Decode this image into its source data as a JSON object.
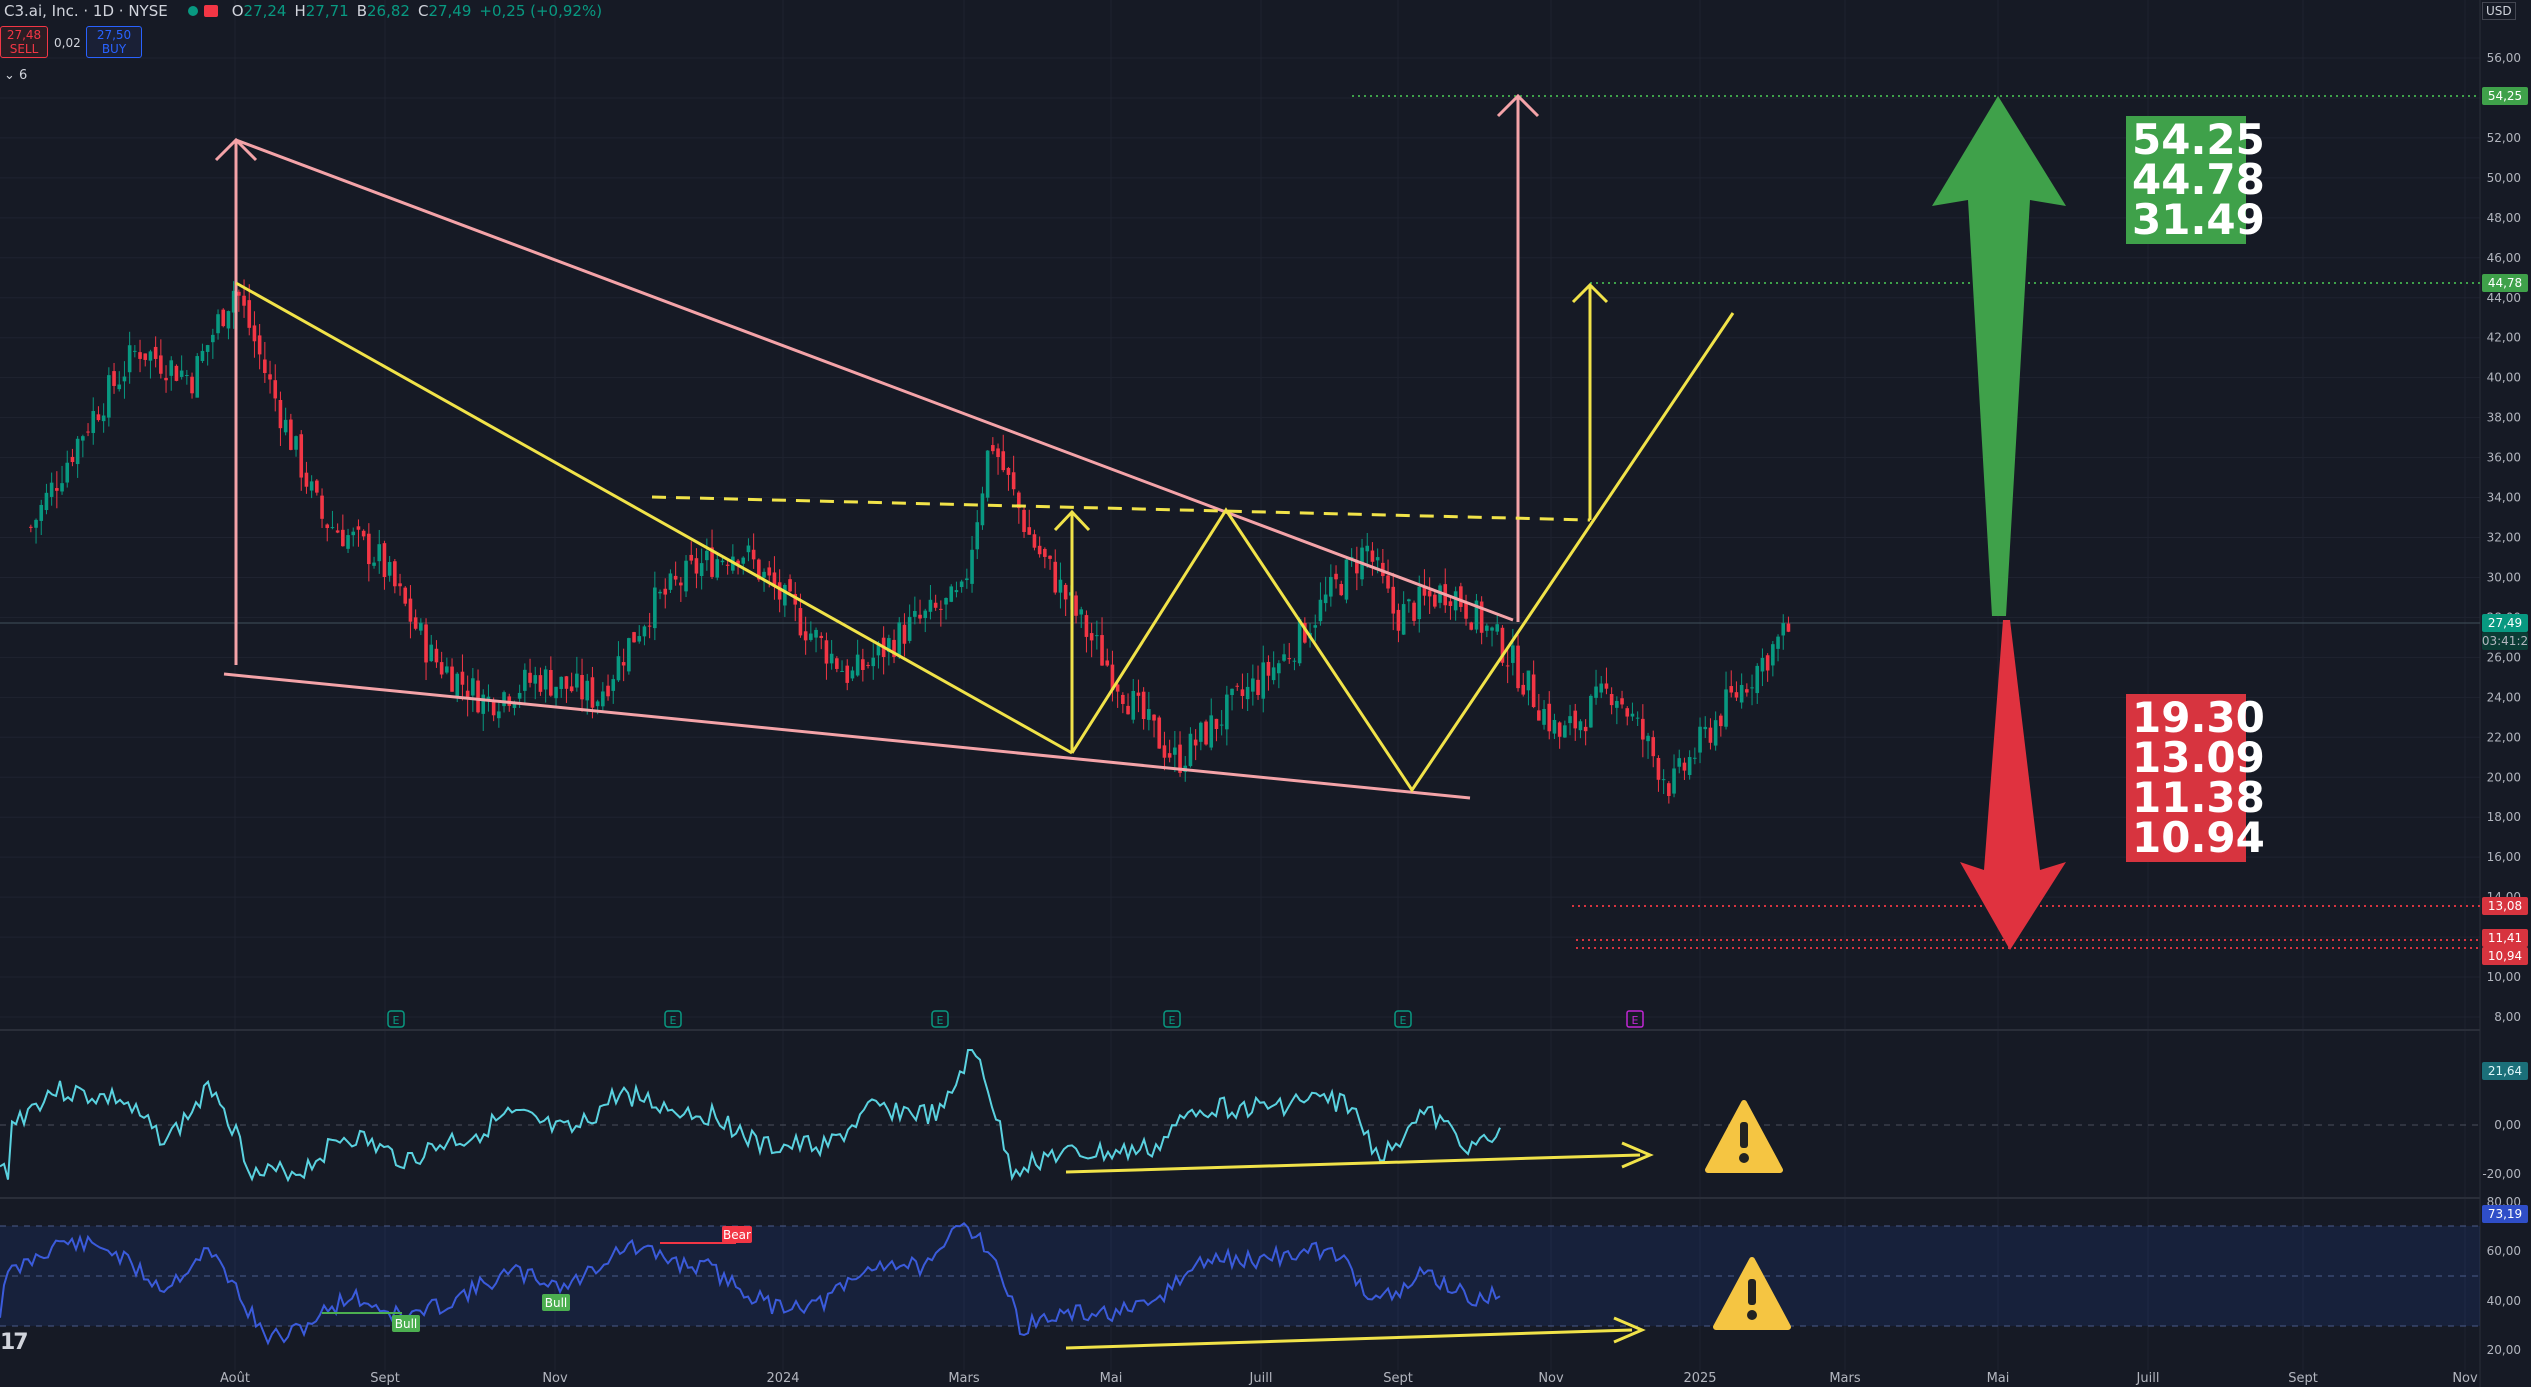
{
  "header": {
    "symbol": "C3.ai, Inc. · 1D · NYSE",
    "open_label": "O",
    "open": "27,24",
    "high_label": "H",
    "high": "27,71",
    "low_label": "B",
    "low": "26,82",
    "close_label": "C",
    "close": "27,49",
    "change": "+0,25 (+0,92%)"
  },
  "trade": {
    "sell_price": "27,48",
    "sell_label": "SELL",
    "spread": "0,02",
    "buy_price": "27,50",
    "buy_label": "BUY",
    "indicators_collapsed": "⌄ 6"
  },
  "currency": "USD",
  "targets": {
    "upside": [
      "54.25",
      "44.78",
      "31.49"
    ],
    "downside": [
      "19.30",
      "13.09",
      "11.38",
      "10.94"
    ]
  },
  "price_tags": {
    "t1": "54,25",
    "t2": "44,78",
    "current": "27,49",
    "countdown": "03:41:2",
    "s1": "13,08",
    "s2": "11,41",
    "s3": "10,94"
  },
  "colors": {
    "background": "#161a25",
    "bull_candle": "#089981",
    "bear_candle": "#f23645",
    "wedge": "#f4a3a8",
    "pattern": "#f1e349",
    "oscillator1": "#5ad2e0",
    "oscillator2": "#3b5bdb",
    "target_up": "#3fa14a",
    "target_down": "#d7343f"
  },
  "indicator_labels": {
    "osc1_value": "21,64",
    "osc2_value": "73,19",
    "bull1": "Bull",
    "bull2": "Bull",
    "bear1": "Bear",
    "earnings_marker": "E"
  },
  "chart_data": {
    "type": "candlestick",
    "title": "",
    "y_axis": {
      "ticks": [
        "56,00",
        "54,00",
        "52,00",
        "50,00",
        "48,00",
        "46,00",
        "44,00",
        "42,00",
        "40,00",
        "38,00",
        "36,00",
        "34,00",
        "32,00",
        "30,00",
        "28,00",
        "26,00",
        "24,00",
        "22,00",
        "20,00",
        "18,00",
        "16,00",
        "14,00",
        "12,00",
        "10,00",
        "8,00"
      ],
      "ylim": [
        7,
        57
      ]
    },
    "x_axis": {
      "tick_labels": [
        "Août",
        "Sept",
        "Nov",
        "2024",
        "Mars",
        "Mai",
        "Juill",
        "Sept",
        "Nov",
        "2025",
        "Mars",
        "Mai",
        "Juill",
        "Sept",
        "Nov"
      ]
    },
    "price_path": [
      {
        "x": "2023-06-05",
        "y": 32.5
      },
      {
        "x": "2023-06-20",
        "y": 37.5
      },
      {
        "x": "2023-07-05",
        "y": 41.5
      },
      {
        "x": "2023-07-20",
        "y": 40.0
      },
      {
        "x": "2023-08-01",
        "y": 44.6
      },
      {
        "x": "2023-08-10",
        "y": 40.0
      },
      {
        "x": "2023-08-25",
        "y": 33.0
      },
      {
        "x": "2023-09-10",
        "y": 31.0
      },
      {
        "x": "2023-09-25",
        "y": 26.0
      },
      {
        "x": "2023-10-10",
        "y": 23.8
      },
      {
        "x": "2023-10-25",
        "y": 25.0
      },
      {
        "x": "2023-11-10",
        "y": 24.0
      },
      {
        "x": "2023-11-25",
        "y": 28.5
      },
      {
        "x": "2023-12-08",
        "y": 30.5
      },
      {
        "x": "2023-12-20",
        "y": 31.5
      },
      {
        "x": "2024-01-05",
        "y": 28.0
      },
      {
        "x": "2024-01-20",
        "y": 25.0
      },
      {
        "x": "2024-02-05",
        "y": 27.5
      },
      {
        "x": "2024-02-20",
        "y": 29.0
      },
      {
        "x": "2024-02-28",
        "y": 37.0
      },
      {
        "x": "2024-03-10",
        "y": 32.0
      },
      {
        "x": "2024-03-25",
        "y": 27.5
      },
      {
        "x": "2024-04-10",
        "y": 23.0
      },
      {
        "x": "2024-04-20",
        "y": 20.8
      },
      {
        "x": "2024-05-05",
        "y": 23.5
      },
      {
        "x": "2024-05-20",
        "y": 26.0
      },
      {
        "x": "2024-06-01",
        "y": 29.0
      },
      {
        "x": "2024-06-12",
        "y": 31.5
      },
      {
        "x": "2024-06-20",
        "y": 28.0
      },
      {
        "x": "2024-07-05",
        "y": 29.5
      },
      {
        "x": "2024-07-20",
        "y": 26.5
      },
      {
        "x": "2024-08-05",
        "y": 22.0
      },
      {
        "x": "2024-08-20",
        "y": 24.5
      },
      {
        "x": "2024-09-05",
        "y": 19.5
      },
      {
        "x": "2024-09-20",
        "y": 23.5
      },
      {
        "x": "2024-10-08",
        "y": 27.49
      }
    ],
    "annotations": {
      "upside_targets": [
        54.25,
        44.78,
        31.49
      ],
      "downside_targets": [
        19.3,
        13.09,
        11.38,
        10.94
      ],
      "current_price": 27.49
    },
    "oscillator_1": {
      "value": "21,64",
      "ticks": [
        "0,00",
        "-20,00"
      ]
    },
    "oscillator_2": {
      "value": "73,19",
      "ticks": [
        "80,00",
        "60,00",
        "40,00",
        "20,00"
      ]
    },
    "grid": true,
    "legend": "none"
  }
}
